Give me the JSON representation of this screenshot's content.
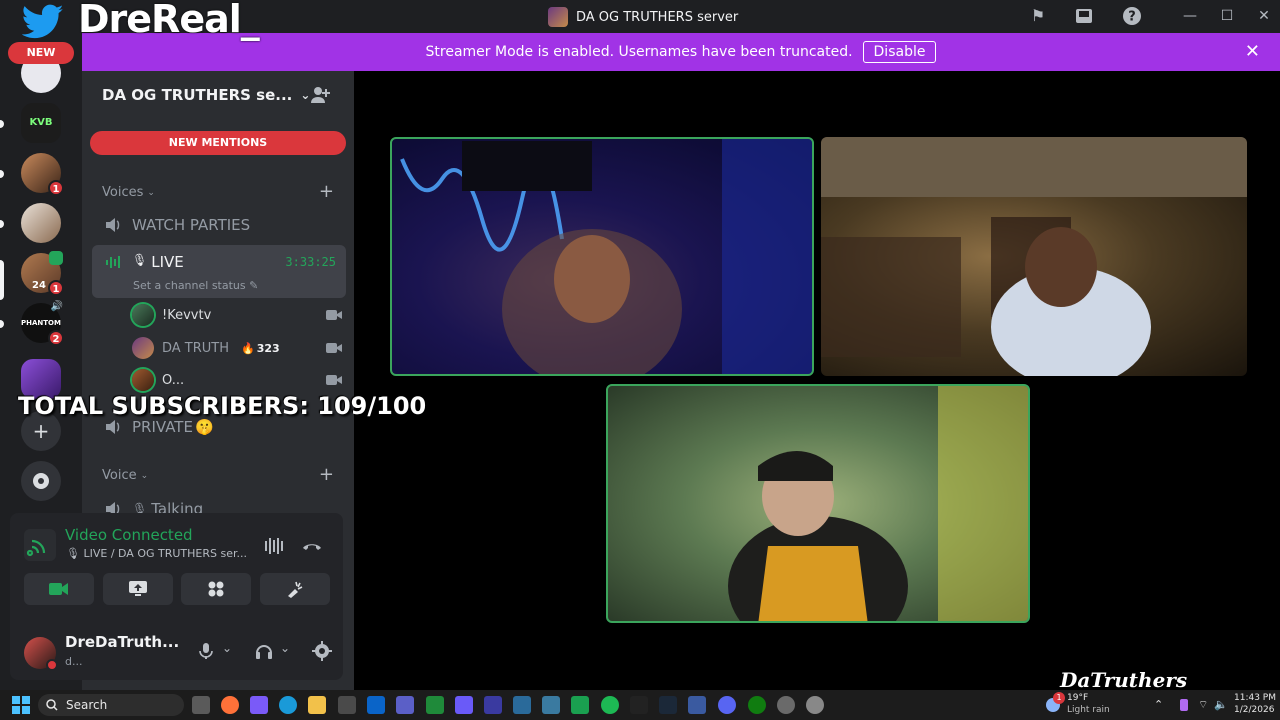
{
  "window": {
    "title": "DA OG TRUTHERS server"
  },
  "overlay": {
    "handle": "DreReal_",
    "new_pill": "NEW",
    "subscribers": "TOTAL SUBSCRIBERS: 109/100",
    "watermark": "DaTruthers"
  },
  "banner": {
    "text": "Streamer Mode is enabled. Usernames have been truncated.",
    "button": "Disable"
  },
  "rail": {
    "servers": [
      {
        "name": "server-1",
        "badge": ""
      },
      {
        "name": "kvb",
        "label": "KVB",
        "badge": ""
      },
      {
        "name": "server-3",
        "badge": "1"
      },
      {
        "name": "server-4",
        "badge": ""
      },
      {
        "name": "server-5",
        "badge": "1",
        "corner": "24"
      },
      {
        "name": "phantom",
        "label": "PHANTOM",
        "badge": "2"
      },
      {
        "name": "server-7",
        "badge": ""
      }
    ]
  },
  "sidebar": {
    "server_name": "DA OG TRUTHERS se...",
    "new_mentions": "NEW MENTIONS",
    "voices_category": "Voices",
    "voice_category": "Voice",
    "channels": {
      "watch_parties": "WATCH PARTIES",
      "live": "LIVE",
      "live_timer": "3:33:25",
      "live_status": "Set a channel status",
      "private": "PRIVATE",
      "private_emoji": "🤫",
      "talking": "Talking"
    },
    "voice_users": [
      {
        "name": "!Kevvtv",
        "speaking": true
      },
      {
        "name": "DA TRUTH",
        "boost": "323",
        "speaking": false
      },
      {
        "name": "O...",
        "speaking": true
      }
    ]
  },
  "voice_panel": {
    "status": "Video Connected",
    "channel": "LIVE / DA OG TRUTHERS ser..."
  },
  "user": {
    "name": "DreDaTruth...",
    "subtext": "d..."
  },
  "taskbar": {
    "search_placeholder": "Search",
    "weather_temp": "19°F",
    "weather_desc": "Light rain",
    "weather_badge": "1",
    "time": "11:43 PM",
    "date": "1/2/2026"
  },
  "colors": {
    "banner": "#a133e6",
    "mentions": "#da373c",
    "connected": "#23a55a",
    "speaking_border": "#3ba55c"
  }
}
